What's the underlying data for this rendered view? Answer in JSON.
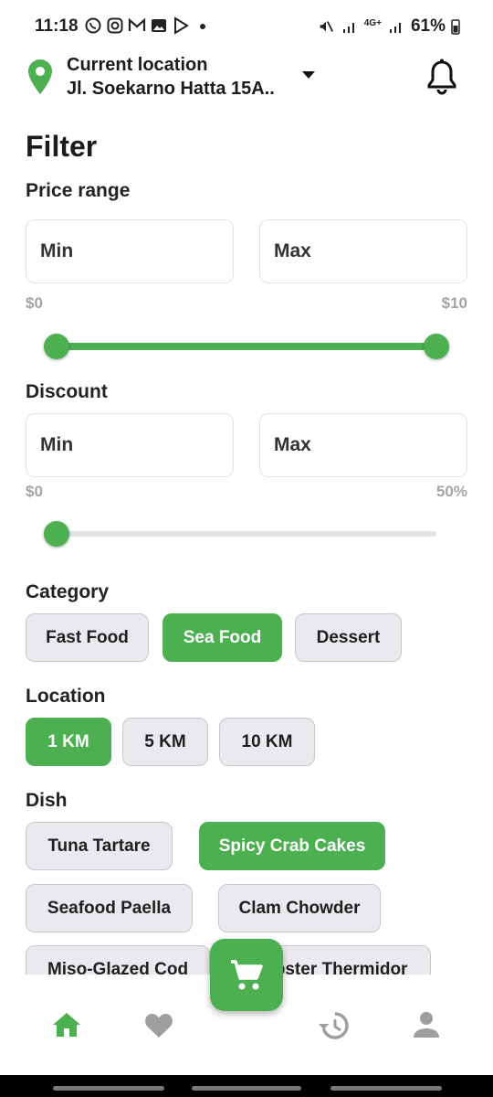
{
  "status_bar": {
    "time": "11:18",
    "network": "4G+",
    "battery": "61%"
  },
  "header": {
    "location_title": "Current location",
    "location_address": "Jl. Soekarno Hatta 15A.."
  },
  "page_title": "Filter",
  "price_range": {
    "label": "Price range",
    "min_placeholder": "Min",
    "max_placeholder": "Max",
    "range_min_label": "$0",
    "range_max_label": "$10",
    "slider_low": 0,
    "slider_high": 1
  },
  "discount": {
    "label": "Discount",
    "min_placeholder": "Min",
    "max_placeholder": "Max",
    "range_min_label": "$0",
    "range_max_label": "50%",
    "slider_value": 0
  },
  "category": {
    "label": "Category",
    "options": [
      "Fast Food",
      "Sea Food",
      "Dessert"
    ],
    "selected": "Sea Food"
  },
  "location": {
    "label": "Location",
    "options": [
      "1 KM",
      "5 KM",
      "10 KM"
    ],
    "selected": "1 KM"
  },
  "dish": {
    "label": "Dish",
    "options": [
      "Tuna Tartare",
      "Spicy Crab Cakes",
      "Seafood Paella",
      "Clam Chowder",
      "Miso-Glazed Cod",
      "Lobster Thermidor"
    ],
    "selected": "Spicy Crab Cakes"
  },
  "bottom_nav": {
    "items": [
      "home-icon",
      "heart-icon",
      "cart-icon",
      "history-icon",
      "profile-icon"
    ],
    "active": "home-icon"
  },
  "colors": {
    "accent": "#4caf50",
    "chip_bg": "#ece9ee",
    "muted": "#a3a3a3"
  }
}
